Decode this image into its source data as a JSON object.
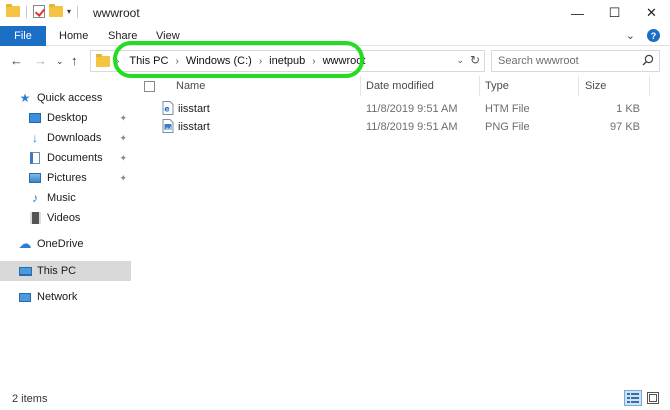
{
  "window": {
    "title": "wwwroot",
    "controls": {
      "minimize": "—",
      "maximize": "☐",
      "close": "✕"
    }
  },
  "ribbon": {
    "file": "File",
    "tabs": [
      "Home",
      "Share",
      "View"
    ],
    "expand_glyph": "⌄",
    "help_glyph": "?"
  },
  "nav": {
    "back": "←",
    "forward": "→",
    "recent": "⌄",
    "up": "↑"
  },
  "address": {
    "lead_sep": "›",
    "crumbs": [
      "This PC",
      "Windows (C:)",
      "inetpub",
      "wwwroot"
    ],
    "dropdown_glyph": "⌄",
    "refresh_glyph": "↻",
    "highlight_color": "#22dd22"
  },
  "search": {
    "placeholder": "Search wwwroot"
  },
  "sidebar": {
    "pin_glyph": "📌",
    "items": [
      {
        "label": "Quick access",
        "icon": "star-icon"
      },
      {
        "label": "Desktop",
        "icon": "desktop-icon",
        "pinned": true
      },
      {
        "label": "Downloads",
        "icon": "download-icon",
        "pinned": true
      },
      {
        "label": "Documents",
        "icon": "documents-icon",
        "pinned": true
      },
      {
        "label": "Pictures",
        "icon": "pictures-icon",
        "pinned": true
      },
      {
        "label": "Music",
        "icon": "music-icon"
      },
      {
        "label": "Videos",
        "icon": "videos-icon"
      },
      {
        "label": "OneDrive",
        "icon": "cloud-icon"
      },
      {
        "label": "This PC",
        "icon": "computer-icon",
        "selected": true
      },
      {
        "label": "Network",
        "icon": "network-icon"
      }
    ]
  },
  "columns": {
    "name": "Name",
    "date": "Date modified",
    "type": "Type",
    "size": "Size"
  },
  "files": [
    {
      "name": "iisstart",
      "date": "11/8/2019 9:51 AM",
      "type": "HTM File",
      "size": "1 KB",
      "icon": "html-file-icon"
    },
    {
      "name": "iisstart",
      "date": "11/8/2019 9:51 AM",
      "type": "PNG File",
      "size": "97 KB",
      "icon": "image-file-icon"
    }
  ],
  "status": {
    "item_count": "2 items"
  },
  "colors": {
    "accent": "#1a6ec4",
    "selected_bg": "#d9d9d9"
  }
}
